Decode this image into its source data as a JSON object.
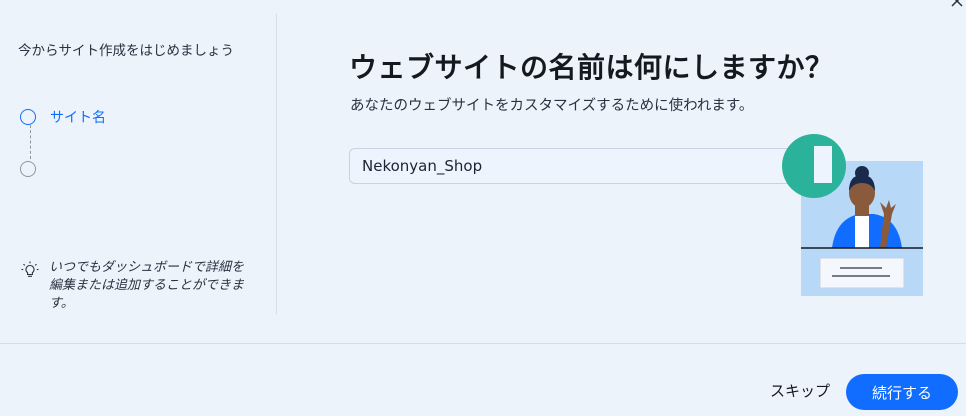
{
  "sidebar": {
    "title": "今からサイト作成をはじめましょう",
    "steps": [
      {
        "label": "サイト名",
        "state": "active"
      },
      {
        "label": "",
        "state": "pending"
      }
    ],
    "tip": "いつでもダッシュボードで詳細を編集または追加することができます。",
    "tip_icon": "lightbulb-icon"
  },
  "main": {
    "title": "ウェブサイトの名前は何にしますか？",
    "subtitle": "あなたのウェブサイトをカスタマイズするために使われます。",
    "site_name_input": {
      "value": "Nekonyan_Shop",
      "placeholder": ""
    }
  },
  "footer": {
    "skip_label": "スキップ",
    "continue_label": "続行する"
  },
  "colors": {
    "accent": "#116dff",
    "background": "#edf3fb",
    "illustration_bg": "#b8d8f8",
    "illustration_accent": "#2ab39a"
  }
}
